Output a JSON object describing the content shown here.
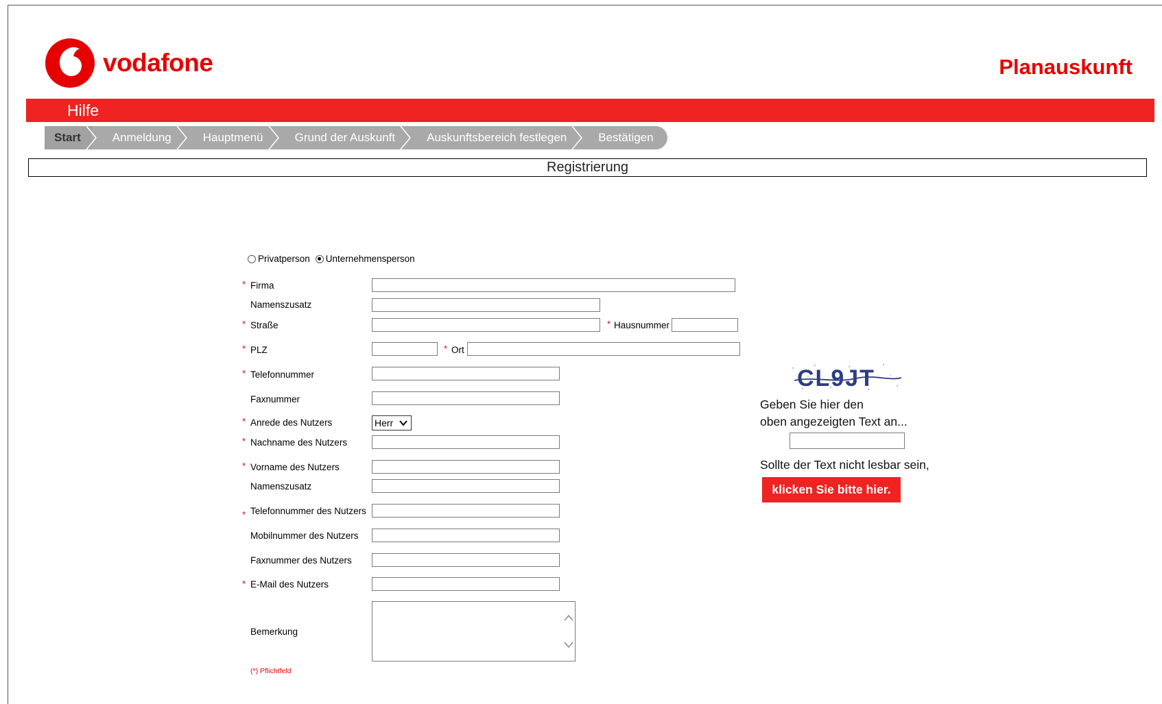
{
  "header": {
    "brand": "vodafone",
    "title": "Planauskunft",
    "help_label": "Hilfe",
    "accent_color": "#e60000"
  },
  "breadcrumb": [
    "Start",
    "Anmeldung",
    "Hauptmenü",
    "Grund der Auskunft",
    "Auskunftsbereich festlegen",
    "Bestätigen"
  ],
  "section_title": "Registrierung",
  "form": {
    "person_type": {
      "options": [
        "Privatperson",
        "Unternehmensperson"
      ],
      "selected": "Unternehmensperson"
    },
    "labels": {
      "firma": "Firma",
      "namenszusatz": "Namenszusatz",
      "strasse": "Straße",
      "hausnummer": "Hausnummer",
      "plz": "PLZ",
      "ort": "Ort",
      "telefonnummer": "Telefonnummer",
      "faxnummer": "Faxnummer",
      "anrede": "Anrede des Nutzers",
      "nachname": "Nachname des Nutzers",
      "vorname": "Vorname des Nutzers",
      "namenszusatz_nutzer": "Namenszusatz",
      "telefon_nutzer": "Telefonnummer des Nutzers",
      "mobil_nutzer": "Mobilnummer des Nutzers",
      "fax_nutzer": "Faxnummer des Nutzers",
      "email_nutzer": "E-Mail des Nutzers",
      "bemerkung": "Bemerkung"
    },
    "required_marker": "*",
    "anrede_value": "Herr",
    "required_hint": "(*) Pflichtfeld"
  },
  "captcha": {
    "image_text": "CL9JT",
    "instruction_line1": "Geben Sie hier den",
    "instruction_line2": "oben angezeigten Text an...",
    "unreadable_text": "Sollte der Text nicht lesbar sein,",
    "refresh_button": "klicken Sie bitte hier."
  }
}
